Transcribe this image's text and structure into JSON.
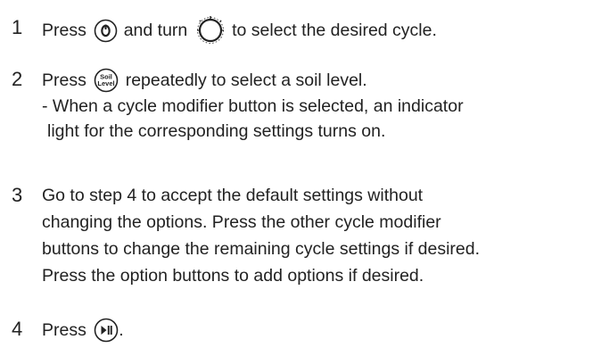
{
  "steps": [
    {
      "number": "1",
      "parts": [
        "Press",
        "and turn",
        "to select the desired cycle."
      ],
      "icons": [
        "power-button-icon",
        "cycle-dial-icon"
      ]
    },
    {
      "number": "2",
      "parts": [
        "Press",
        "repeatedly to select a soil level."
      ],
      "icon_label": [
        "Soil",
        "Level"
      ],
      "note": [
        "- When a cycle modifier button is selected, an indicator",
        "light for the corresponding settings turns on."
      ]
    },
    {
      "number": "3",
      "lines": [
        "Go to step 4 to accept the default settings without",
        "changing the options. Press the other cycle modifier",
        "buttons to change the remaining cycle settings if desired.",
        "Press the option buttons to add options if desired."
      ]
    },
    {
      "number": "4",
      "parts": [
        "Press",
        "."
      ],
      "icons": [
        "play-pause-button-icon"
      ]
    }
  ]
}
